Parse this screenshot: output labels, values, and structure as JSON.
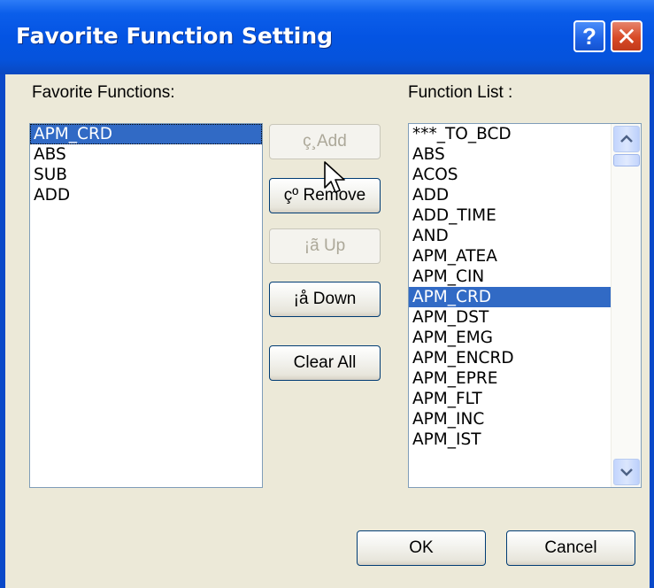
{
  "window": {
    "title": "Favorite Function Setting",
    "help_glyph": "?",
    "close_glyph": "✕"
  },
  "favorites": {
    "label": "Favorite Functions:",
    "items": [
      "APM_CRD",
      "ABS",
      "SUB",
      "ADD"
    ],
    "selected_index": 0
  },
  "function_list": {
    "label": "Function List :",
    "items": [
      "***_TO_BCD",
      "ABS",
      "ACOS",
      "ADD",
      "ADD_TIME",
      "AND",
      "APM_ATEA",
      "APM_CIN",
      "APM_CRD",
      "APM_DST",
      "APM_EMG",
      "APM_ENCRD",
      "APM_EPRE",
      "APM_FLT",
      "APM_INC",
      "APM_IST"
    ],
    "selected_index": 8
  },
  "buttons": {
    "add": "ç¸Add",
    "remove": "çº Remove",
    "up": "¡ã Up",
    "down": "¡å Down",
    "clear_all": "Clear All",
    "ok": "OK",
    "cancel": "Cancel"
  },
  "colors": {
    "selection": "#316ac5",
    "titlebar": "#0454e3",
    "dialog_face": "#ece9d8"
  },
  "icons": {
    "scroll_up": "chevron-up-icon",
    "scroll_down": "chevron-down-icon",
    "cursor": "arrow-cursor-icon"
  }
}
